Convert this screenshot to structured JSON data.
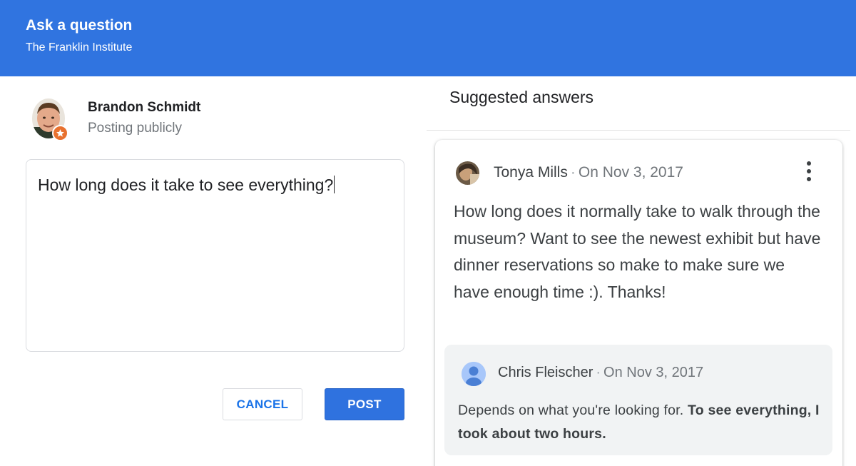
{
  "header": {
    "title": "Ask a question",
    "subtitle": "The Franklin Institute"
  },
  "composer": {
    "user_name": "Brandon Schmidt",
    "visibility": "Posting publicly",
    "question_text": "How long does it take to see everything?",
    "cancel_label": "CANCEL",
    "post_label": "POST"
  },
  "suggested": {
    "title": "Suggested answers",
    "question": {
      "author": "Tonya Mills",
      "date": "On Nov 3, 2017",
      "text": "How long does it normally take to walk through the museum? Want to see the newest exhibit but have dinner reservations so make to make sure we have enough time :). Thanks!"
    },
    "answer": {
      "author": "Chris Fleischer",
      "date": "On Nov 3, 2017",
      "text_plain": "Depends on what you're looking for. ",
      "text_bold": "To see everything, I took about two hours."
    }
  },
  "icons": {
    "badge": "local-guide-star-icon",
    "more": "more-vert-icon",
    "default_avatar": "person-icon"
  },
  "colors": {
    "header_bg": "#3074e0",
    "primary_button": "#2f72df",
    "link_blue": "#1a73e8",
    "badge_orange": "#e8712f",
    "answer_bg": "#f1f3f4"
  }
}
